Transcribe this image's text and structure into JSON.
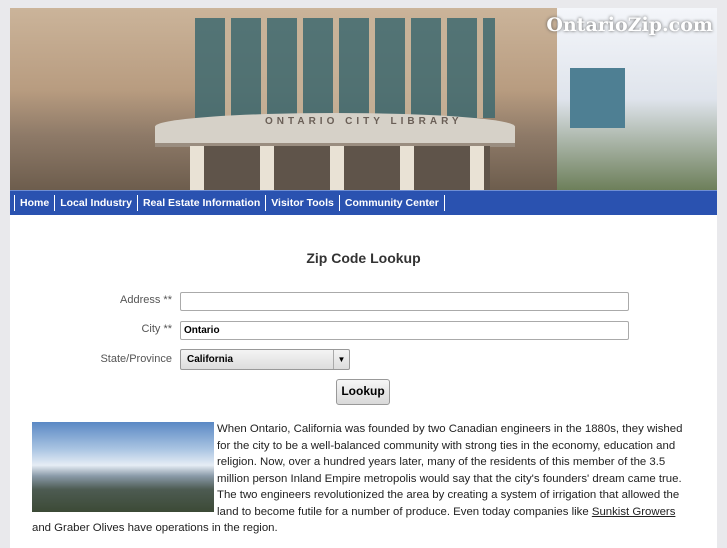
{
  "banner": {
    "logo_text": "OntarioZip.com",
    "sign_text": "ONTARIO CITY LIBRARY"
  },
  "nav": {
    "items": [
      {
        "label": "Home"
      },
      {
        "label": "Local Industry"
      },
      {
        "label": "Real Estate Information"
      },
      {
        "label": "Visitor Tools"
      },
      {
        "label": "Community Center"
      }
    ]
  },
  "form": {
    "title": "Zip Code Lookup",
    "address_label": "Address **",
    "address_value": "",
    "city_label": "City **",
    "city_value": "Ontario",
    "state_label": "State/Province",
    "state_value": "California",
    "submit_label": "Lookup"
  },
  "article": {
    "text_before": "When Ontario, California was founded by two Canadian engineers in the 1880s, they wished for the city to be a well-balanced community with strong ties in the economy, education and religion. Now, over a hundred years later, many of the residents of this member of the 3.5 million person Inland Empire metropolis would say that the city's founders' dream came true. The two engineers revolutionized the area by creating a system of irrigation that allowed the land to become futile for a number of produce. Even today companies like ",
    "link": "Sunkist Growers",
    "text_after": " and Graber Olives have operations in the region."
  }
}
